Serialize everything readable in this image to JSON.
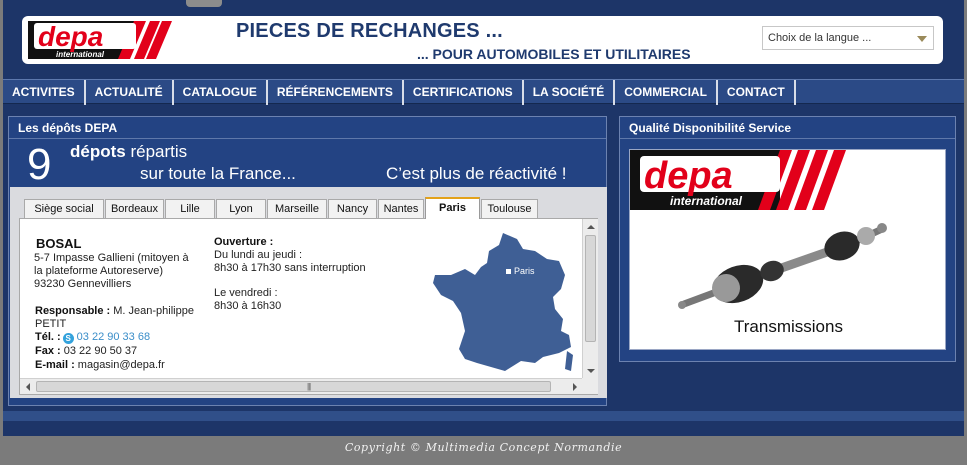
{
  "header": {
    "logo_text": "depa",
    "logo_subtext": "international",
    "title_main": "PIECES DE RECHANGES ...",
    "title_sub": "... POUR AUTOMOBILES ET UTILITAIRES",
    "language_placeholder": "Choix de la langue ..."
  },
  "nav": {
    "items": [
      "ACTIVITES",
      "ACTUALITÉ",
      "CATALOGUE",
      "RÉFÉRENCEMENTS",
      "CERTIFICATIONS",
      "LA SOCIÉTÉ",
      "COMMERCIAL",
      "CONTACT"
    ]
  },
  "depots_panel": {
    "title": "Les dépôts DEPA",
    "count": "9",
    "line1_bold": "dépots",
    "line1_rest": " répartis",
    "line2": "sur toute la France...",
    "tagline": "C’est plus de réactivité !",
    "tabs": [
      "Siège social",
      "Bordeaux",
      "Lille",
      "Lyon",
      "Marseille",
      "Nancy",
      "Nantes",
      "Paris",
      "Toulouse"
    ],
    "active_tab": "Paris",
    "contact": {
      "name": "BOSAL",
      "address": "5-7 Impasse Gallieni (mitoyen à la plateforme Autoreserve) 93230 Gennevilliers",
      "responsable_label": "Responsable :",
      "responsable_value": " M. Jean-philippe PETIT",
      "tel_label": "Tél. :",
      "tel_value": "03 22 90 33 68",
      "fax_label": "Fax :",
      "fax_value": " 03 22 90 50 37",
      "email_label": "E-mail :",
      "email_value": " magasin@depa.fr"
    },
    "hours": {
      "label": "Ouverture :",
      "weekdays": "Du lundi au jeudi :",
      "weekday_hours": "8h30 à 17h30 sans interruption",
      "friday": "Le vendredi :",
      "friday_hours": "8h30 à 16h30"
    },
    "map_label": "Paris"
  },
  "service_panel": {
    "title": "Qualité Disponibilité Service",
    "caption": "Transmissions"
  },
  "footer": {
    "copyright": "Copyright © Multimedia Concept Normandie"
  },
  "colors": {
    "navy": "#1d3568",
    "nav_blue": "#2b4a86",
    "panel_blue": "#234383",
    "brand_red": "#e2001a",
    "map_blue": "#3f5f95",
    "active_tab_accent": "#e3a21a"
  }
}
